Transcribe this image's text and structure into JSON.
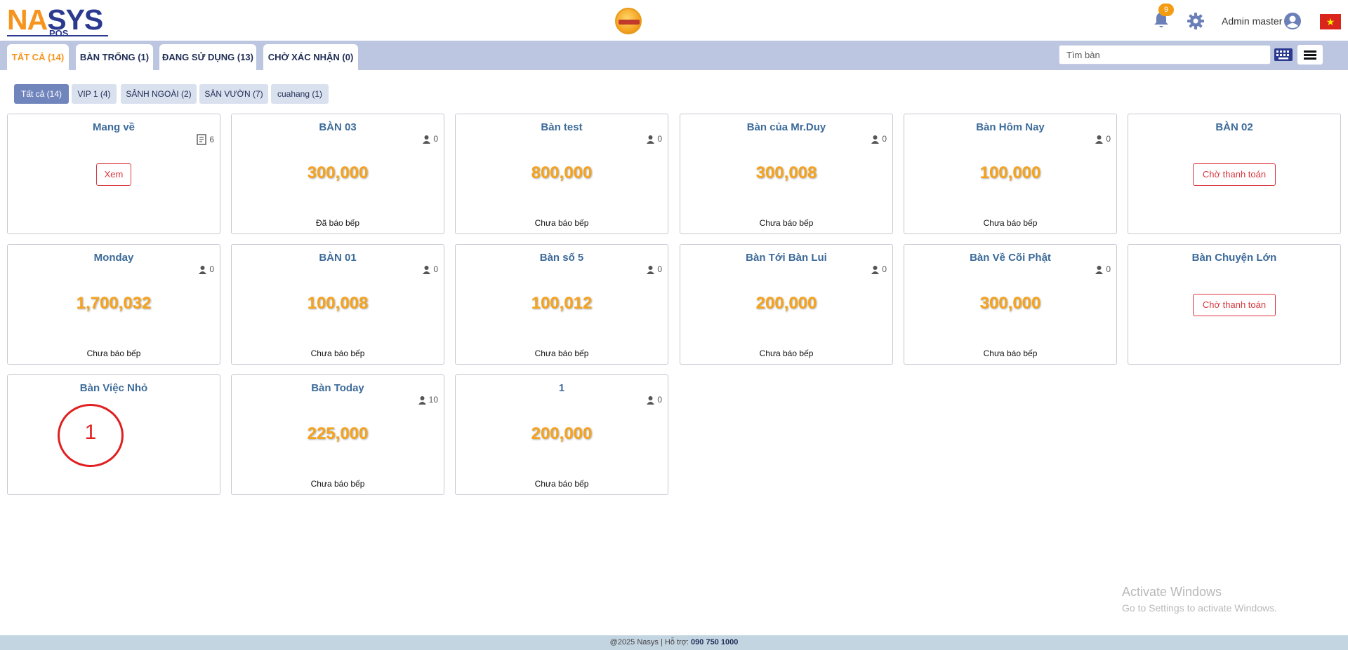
{
  "header": {
    "logo": {
      "part1": "NA",
      "part2": "S",
      "part3": "YS",
      "sub": "POS"
    },
    "notification_count": "9",
    "user_name": "Admin master"
  },
  "tabs": [
    {
      "label": "TẤT CẢ (14)",
      "active": true
    },
    {
      "label": "BÀN TRỐNG (1)",
      "active": false
    },
    {
      "label": "ĐANG SỬ DỤNG (13)",
      "active": false
    },
    {
      "label": "CHỜ XÁC NHẬN (0)",
      "active": false
    }
  ],
  "search": {
    "placeholder": "Tìm bàn"
  },
  "zones": [
    {
      "label": "Tất cả (14)",
      "active": true
    },
    {
      "label": "VIP 1 (4)",
      "active": false
    },
    {
      "label": "SẢNH NGOÀI (2)",
      "active": false
    },
    {
      "label": "SÂN VƯỜN (7)",
      "active": false
    },
    {
      "label": "cuahang (1)",
      "active": false
    }
  ],
  "tables": [
    {
      "name": "Mang về",
      "count": "6",
      "count_icon": "receipt-icon",
      "button": "Xem"
    },
    {
      "name": "BÀN 03",
      "count": "0",
      "amount": "300,000",
      "status": "Đã báo bếp"
    },
    {
      "name": "Bàn test",
      "count": "0",
      "amount": "800,000",
      "status": "Chưa báo bếp"
    },
    {
      "name": "Bàn của Mr.Duy",
      "count": "0",
      "amount": "300,008",
      "status": "Chưa báo bếp"
    },
    {
      "name": "Bàn Hôm Nay",
      "count": "0",
      "amount": "100,000",
      "status": "Chưa báo bếp"
    },
    {
      "name": "BÀN 02",
      "button": "Chờ thanh toán"
    },
    {
      "name": "Monday",
      "count": "0",
      "amount": "1,700,032",
      "status": "Chưa báo bếp"
    },
    {
      "name": "BÀN 01",
      "count": "0",
      "amount": "100,008",
      "status": "Chưa báo bếp"
    },
    {
      "name": "Bàn số 5",
      "count": "0",
      "amount": "100,012",
      "status": "Chưa báo bếp"
    },
    {
      "name": "Bàn Tới Bàn Lui",
      "count": "0",
      "amount": "200,000",
      "status": "Chưa báo bếp"
    },
    {
      "name": "Bàn Về Cõi Phật",
      "count": "0",
      "amount": "300,000",
      "status": "Chưa báo bếp"
    },
    {
      "name": "Bàn Chuyện Lớn",
      "button": "Chờ thanh toán"
    },
    {
      "name": "Bàn Việc Nhỏ"
    },
    {
      "name": "Bàn Today",
      "count": "10",
      "amount": "225,000",
      "status": "Chưa báo bếp"
    },
    {
      "name": "1",
      "count": "0",
      "amount": "200,000",
      "status": "Chưa báo bếp"
    }
  ],
  "annotation": {
    "label": "1"
  },
  "watermark": {
    "title": "Activate Windows",
    "subtitle": "Go to Settings to activate Windows."
  },
  "footer": {
    "text": "@2025 Nasys | Hỗ trợ: ",
    "phone": "090 750 1000"
  },
  "colors": {
    "accent": "#f7941d",
    "brand": "#2b3a8f",
    "danger": "#d9363e",
    "tabbar": "#bcc6e0"
  }
}
